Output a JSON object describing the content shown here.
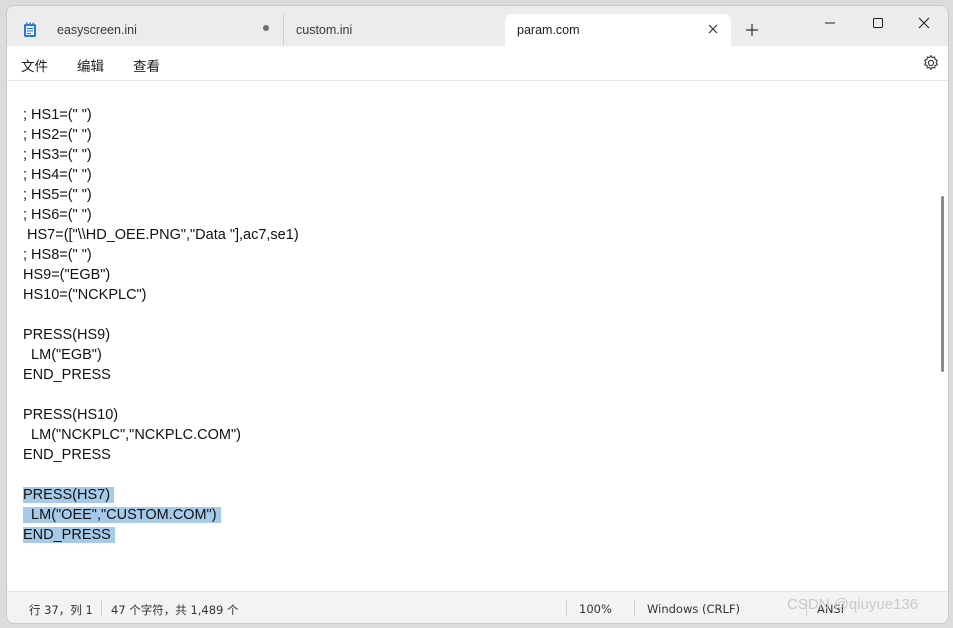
{
  "tabs": [
    {
      "label": "easyscreen.ini"
    },
    {
      "label": "custom.ini"
    },
    {
      "label": "param.com"
    }
  ],
  "menu": {
    "file": "文件",
    "edit": "编辑",
    "view": "查看"
  },
  "lines": [
    {
      "text": "; HS1=(\" \")",
      "selected": false
    },
    {
      "text": "; HS2=(\" \")",
      "selected": false
    },
    {
      "text": "; HS3=(\" \")",
      "selected": false
    },
    {
      "text": "; HS4=(\" \")",
      "selected": false
    },
    {
      "text": "; HS5=(\" \")",
      "selected": false
    },
    {
      "text": "; HS6=(\" \")",
      "selected": false
    },
    {
      "text": " HS7=([\"\\\\HD_OEE.PNG\",\"Data \"],ac7,se1)",
      "selected": false
    },
    {
      "text": "; HS8=(\" \")",
      "selected": false
    },
    {
      "text": "HS9=(\"EGB\")",
      "selected": false
    },
    {
      "text": "HS10=(\"NCKPLC\")",
      "selected": false
    },
    {
      "text": "",
      "selected": false
    },
    {
      "text": "PRESS(HS9)",
      "selected": false
    },
    {
      "text": "  LM(\"EGB\")",
      "selected": false
    },
    {
      "text": "END_PRESS",
      "selected": false
    },
    {
      "text": "",
      "selected": false
    },
    {
      "text": "PRESS(HS10)",
      "selected": false
    },
    {
      "text": "  LM(\"NCKPLC\",\"NCKPLC.COM\")",
      "selected": false
    },
    {
      "text": "END_PRESS",
      "selected": false
    },
    {
      "text": "",
      "selected": false
    },
    {
      "text": "PRESS(HS7)",
      "selected": true
    },
    {
      "text": "  LM(\"OEE\",\"CUSTOM.COM\")",
      "selected": true
    },
    {
      "text": "END_PRESS",
      "selected": true
    }
  ],
  "status": {
    "position": "行 37，列 1",
    "chars": "47 个字符，共 1,489 个",
    "zoom": "100%",
    "line_ending": "Windows (CRLF)",
    "encoding": "ANSI"
  },
  "watermark": "CSDN @qiuyue136",
  "colors": {
    "selection": "#a6cbe9",
    "tab_active": "#ffffff",
    "chrome": "#ececec"
  }
}
